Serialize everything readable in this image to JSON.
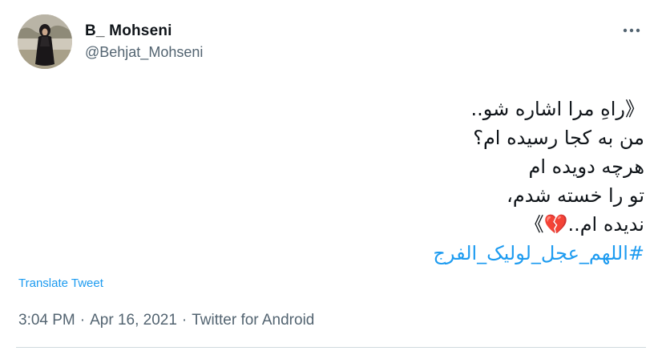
{
  "user": {
    "display_name": "B_ Mohseni",
    "handle": "@Behjat_Mohseni"
  },
  "tweet": {
    "lines": [
      "《راهِ مرا اشاره شو..",
      "من به کجا رسیده ام؟",
      "هرچه دویده ام",
      "تو را خسته شدم،",
      "ندیده ام..💔》"
    ],
    "hashtag": "#اللهم_عجل_لولیک_الفرج"
  },
  "translate_label": "Translate Tweet",
  "meta": {
    "time": "3:04 PM",
    "separator": "·",
    "date": "Apr 16, 2021",
    "source": "Twitter for Android"
  },
  "icons": {
    "more": "more-options-icon",
    "avatar": "profile-photo"
  },
  "colors": {
    "link": "#1d9bf0",
    "secondary": "#536471",
    "text": "#0f1419"
  }
}
